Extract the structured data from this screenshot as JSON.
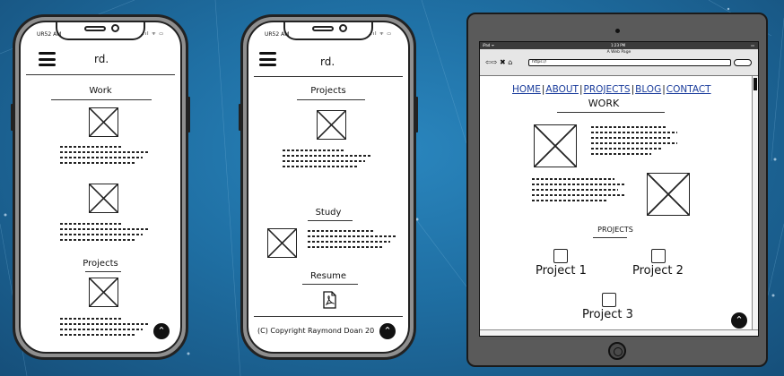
{
  "phone1": {
    "status_time": "UR52 AM",
    "status_icons": "..ıl ᯤ ▭",
    "brand": "rd.",
    "section1_title": "Work",
    "section2_title": "Projects"
  },
  "phone2": {
    "status_time": "UR52 AM",
    "status_icons": "..ıl ᯤ ▭",
    "brand": "rd.",
    "section1_title": "Projects",
    "section2_title": "Study",
    "section3_title": "Resume",
    "copyright": "(C) Copyright Raymond Doan 20"
  },
  "tablet": {
    "status_left": "iPad ᯤ",
    "status_center": "1:23 PM",
    "status_right": "▭",
    "page_title": "A Web Page",
    "nav_buttons": "⇦⇨ ✖ ⌂",
    "url": "https://",
    "nav": [
      "HOME",
      "ABOUT",
      "PROJECTS",
      "BLOG",
      "CONTACT"
    ],
    "work_title": "WORK",
    "projects_title": "PROJECTS",
    "projects": [
      "Project 1",
      "Project 2",
      "Project 3"
    ]
  },
  "icons": {
    "up": "⌃",
    "pdf": "pdf-file-icon"
  }
}
